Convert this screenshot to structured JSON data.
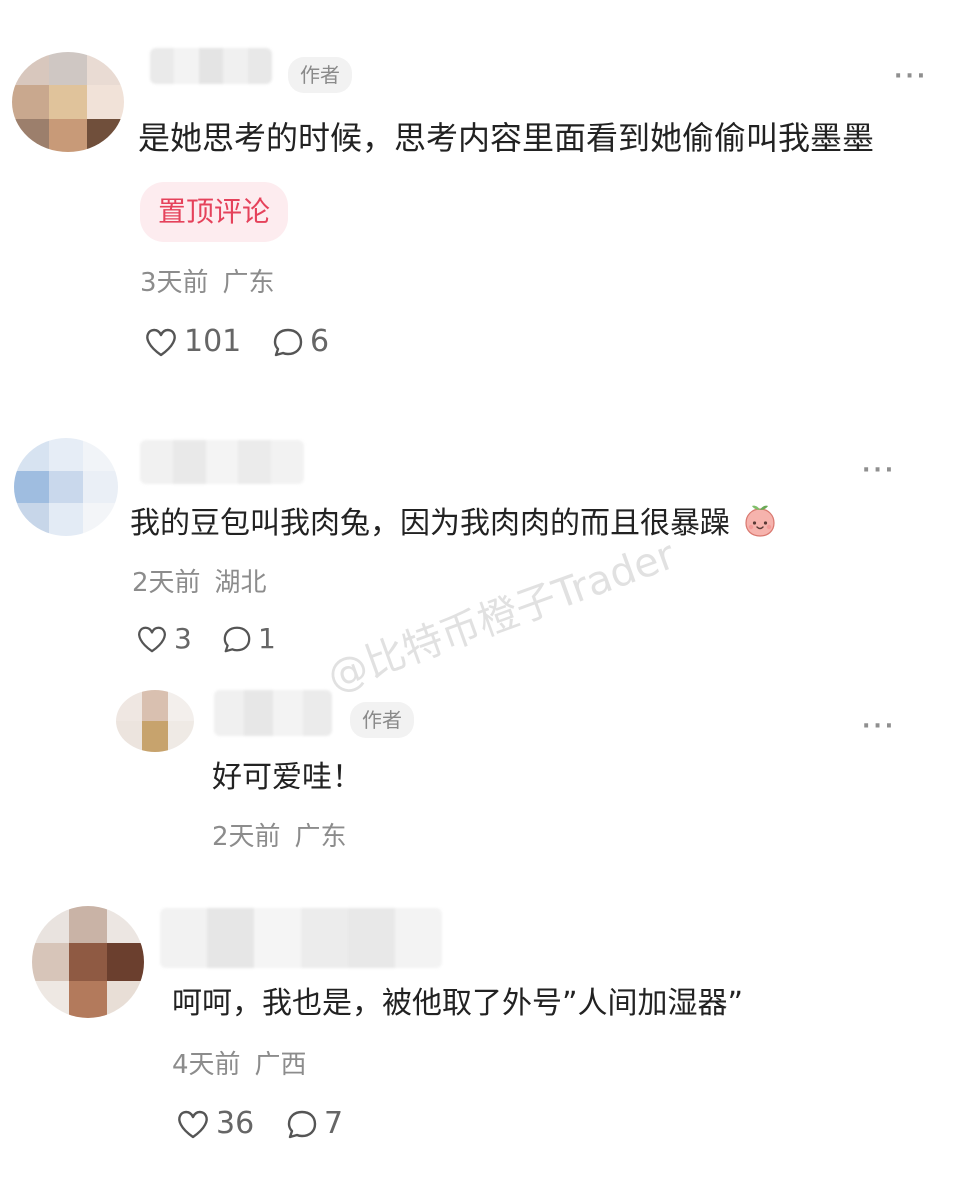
{
  "colors": {
    "pin_accent": "#e5425b",
    "pin_bg": "#fdecef",
    "meta_gray": "#8c8c8c"
  },
  "comments": [
    {
      "author_tag": "作者",
      "text": "是她思考的时候，思考内容里面看到她偷偷叫我墨墨",
      "badge": "置顶评论",
      "time": "3天前",
      "location": "广东",
      "likes": "101",
      "replies": "6",
      "more": "···"
    },
    {
      "text": "我的豆包叫我肉兔，因为我肉肉的而且很暴躁",
      "emoji": "peach-face-emoji",
      "time": "2天前",
      "location": "湖北",
      "likes": "3",
      "replies": "1",
      "more": "···"
    },
    {
      "author_tag": "作者",
      "text": "好可爱哇！",
      "time": "2天前",
      "location": "广东",
      "more": "···"
    },
    {
      "text": "呵呵，我也是，被他取了外号”人间加湿器”",
      "time": "4天前",
      "location": "广西",
      "likes": "36",
      "replies": "7"
    }
  ],
  "watermark": "@比特币橙子Trader",
  "icons": {
    "like": "heart-outline-icon",
    "reply": "comment-bubble-icon",
    "more": "ellipsis-icon"
  }
}
